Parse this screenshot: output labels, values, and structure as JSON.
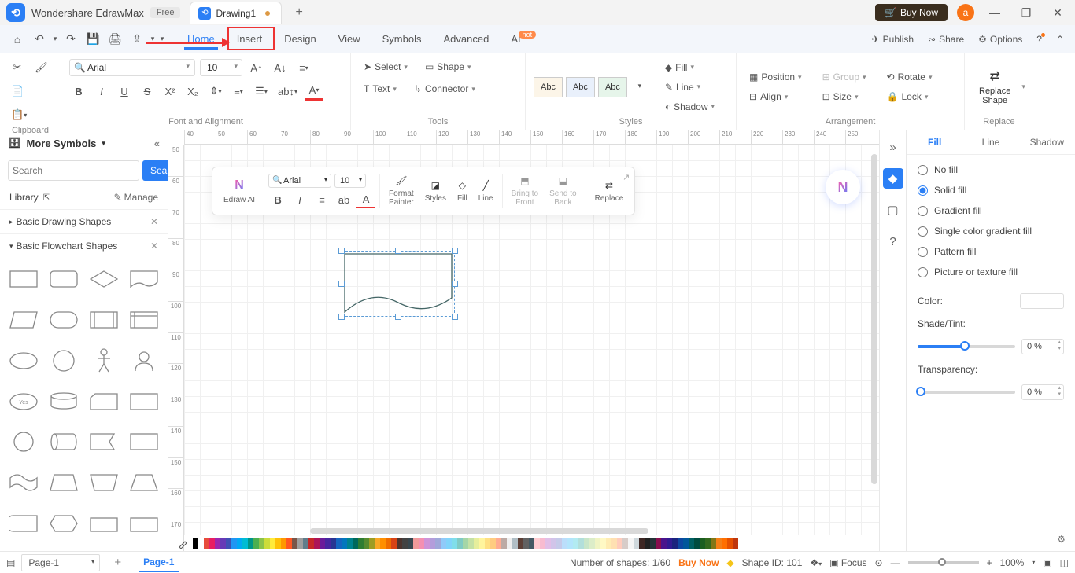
{
  "titlebar": {
    "app_name": "Wondershare EdrawMax",
    "free_badge": "Free",
    "tab_name": "Drawing1",
    "buy_now": "Buy Now",
    "avatar_letter": "a"
  },
  "menubar": {
    "items": [
      "Home",
      "Insert",
      "Design",
      "View",
      "Symbols",
      "Advanced",
      "AI"
    ],
    "hot_badge": "hot",
    "publish": "Publish",
    "share": "Share",
    "options": "Options"
  },
  "ribbon": {
    "clipboard_label": "Clipboard",
    "font_label": "Font and Alignment",
    "tools_label": "Tools",
    "styles_label": "Styles",
    "arrangement_label": "Arrangement",
    "replace_label": "Replace",
    "font_name": "Arial",
    "font_size": "10",
    "select": "Select",
    "shape": "Shape",
    "text": "Text",
    "connector": "Connector",
    "abc": "Abc",
    "fill": "Fill",
    "line": "Line",
    "shadow": "Shadow",
    "position": "Position",
    "align": "Align",
    "group": "Group",
    "size": "Size",
    "rotate": "Rotate",
    "lock": "Lock",
    "replace_shape": "Replace\nShape"
  },
  "left_panel": {
    "more_symbols": "More Symbols",
    "search_placeholder": "Search",
    "search_btn": "Search",
    "library": "Library",
    "manage": "Manage",
    "cat1": "Basic Drawing Shapes",
    "cat2": "Basic Flowchart Shapes"
  },
  "float_toolbar": {
    "edraw_ai": "Edraw AI",
    "font_name": "Arial",
    "font_size": "10",
    "format_painter": "Format\nPainter",
    "styles": "Styles",
    "fill": "Fill",
    "line": "Line",
    "bring_front": "Bring to\nFront",
    "send_back": "Send to\nBack",
    "replace": "Replace"
  },
  "ruler_h": [
    "40",
    "50",
    "60",
    "70",
    "80",
    "90",
    "100",
    "110",
    "120",
    "130",
    "140",
    "150",
    "160",
    "170",
    "180",
    "190",
    "200",
    "210",
    "220",
    "230",
    "240",
    "250"
  ],
  "ruler_v": [
    "50",
    "60",
    "70",
    "80",
    "90",
    "100",
    "110",
    "120",
    "130",
    "140",
    "150",
    "160",
    "170"
  ],
  "right_panel": {
    "tabs": [
      "Fill",
      "Line",
      "Shadow"
    ],
    "no_fill": "No fill",
    "solid_fill": "Solid fill",
    "gradient_fill": "Gradient fill",
    "single_gradient": "Single color gradient fill",
    "pattern_fill": "Pattern fill",
    "picture_fill": "Picture or texture fill",
    "color": "Color:",
    "shade_tint": "Shade/Tint:",
    "transparency": "Transparency:",
    "shade_val": "0 %",
    "trans_val": "0 %"
  },
  "statusbar": {
    "page_name": "Page-1",
    "page_tab": "Page-1",
    "num_shapes": "Number of shapes: 1/60",
    "buy_now": "Buy Now",
    "shape_id": "Shape ID: 101",
    "focus": "Focus",
    "zoom": "100%"
  },
  "color_palette": [
    "#000",
    "#fff",
    "#e74c3c",
    "#e91e63",
    "#9c27b0",
    "#673ab7",
    "#3f51b5",
    "#2196f3",
    "#03a9f4",
    "#00bcd4",
    "#009688",
    "#4caf50",
    "#8bc34a",
    "#cddc39",
    "#ffeb3b",
    "#ffc107",
    "#ff9800",
    "#ff5722",
    "#795548",
    "#9e9e9e",
    "#607d8b",
    "#c62828",
    "#ad1457",
    "#6a1b9a",
    "#4527a0",
    "#283593",
    "#1565c0",
    "#0277bd",
    "#00838f",
    "#00695c",
    "#2e7d32",
    "#558b2f",
    "#9e9d24",
    "#f9a825",
    "#ff8f00",
    "#ef6c00",
    "#d84315",
    "#4e342e",
    "#424242",
    "#37474f",
    "#ef9a9a",
    "#f48fb1",
    "#ce93d8",
    "#b39ddb",
    "#9fa8da",
    "#90caf9",
    "#81d4fa",
    "#80deea",
    "#80cbc4",
    "#a5d6a7",
    "#c5e1a5",
    "#e6ee9c",
    "#fff59d",
    "#ffe082",
    "#ffcc80",
    "#ffab91",
    "#bcaaa4",
    "#eeeeee",
    "#b0bec5",
    "#5d4037",
    "#616161",
    "#455a64",
    "#ffcdd2",
    "#f8bbd0",
    "#e1bee7",
    "#d1c4e9",
    "#c5cae9",
    "#bbdefb",
    "#b3e5fc",
    "#b2ebf2",
    "#b2dfdb",
    "#c8e6c9",
    "#dcedc8",
    "#f0f4c3",
    "#fff9c4",
    "#ffecb3",
    "#ffe0b2",
    "#ffccbc",
    "#d7ccc8",
    "#f5f5f5",
    "#cfd8dc",
    "#3e2723",
    "#212121",
    "#263238",
    "#880e4f",
    "#4a148c",
    "#311b92",
    "#1a237e",
    "#0d47a1",
    "#01579b",
    "#006064",
    "#004d40",
    "#1b5e20",
    "#33691e",
    "#827717",
    "#f57f17",
    "#ff6f00",
    "#e65100",
    "#bf360c"
  ]
}
